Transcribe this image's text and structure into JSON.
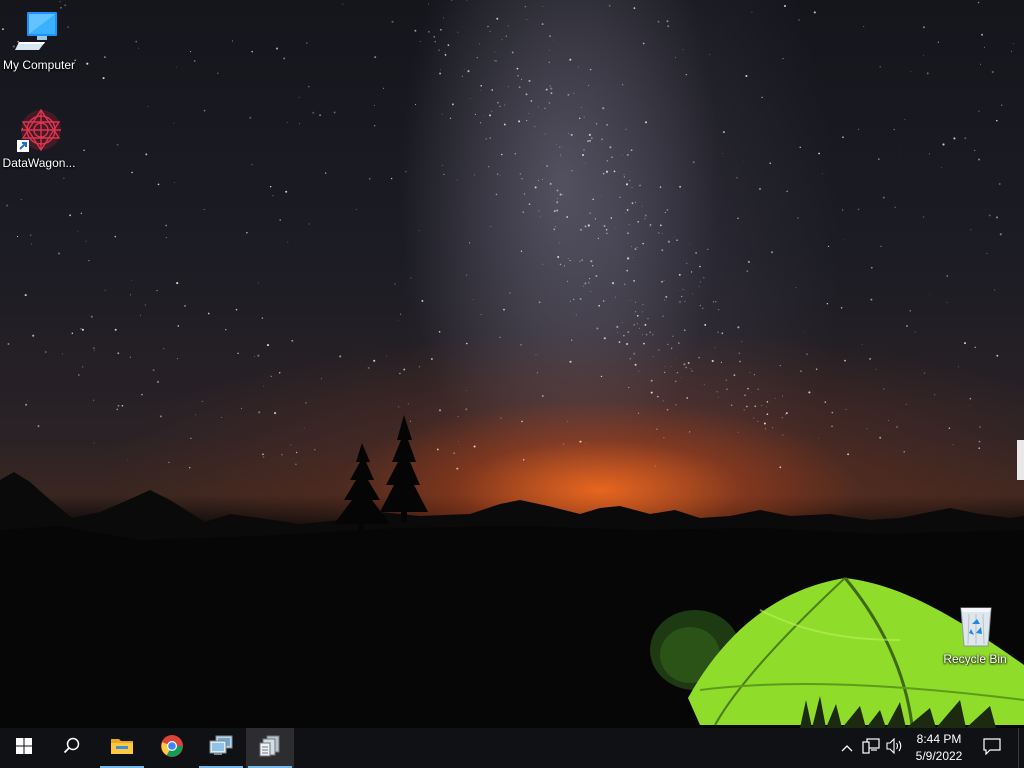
{
  "desktop": {
    "icons": [
      {
        "label": "My Computer",
        "icon": "computer-icon"
      },
      {
        "label": "DataWagon...",
        "icon": "datawagon-icon"
      },
      {
        "label": "Recycle Bin",
        "icon": "recycle-bin-icon"
      }
    ]
  },
  "taskbar": {
    "pinned": [
      {
        "name": "start",
        "icon": "windows-logo-icon"
      },
      {
        "name": "search",
        "icon": "search-icon"
      },
      {
        "name": "file-explorer",
        "icon": "folder-icon"
      },
      {
        "name": "chrome",
        "icon": "chrome-icon"
      },
      {
        "name": "remote-desktop",
        "icon": "remote-desktop-icon"
      },
      {
        "name": "app",
        "icon": "server-manager-icon"
      }
    ],
    "tray": {
      "chevron": "chevron-up-icon",
      "network": "network-icon",
      "volume": "volume-icon",
      "time": "8:44 PM",
      "date": "5/9/2022",
      "notifications": "action-center-icon"
    }
  },
  "colors": {
    "taskbar_bg": "#101114",
    "active_underline": "#76b9ed",
    "tent_green": "#8fdc2a"
  }
}
